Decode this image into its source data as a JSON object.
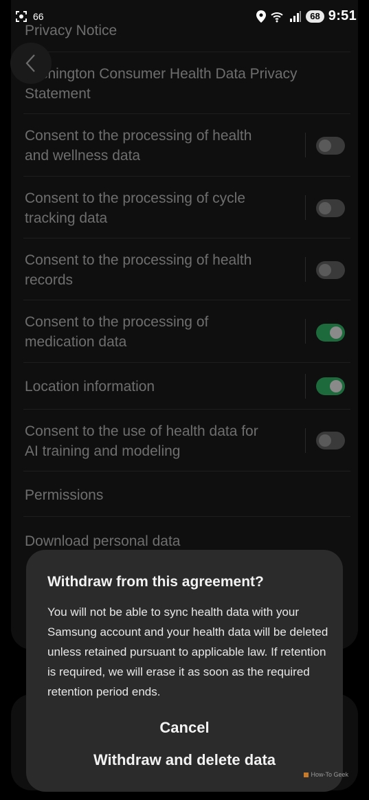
{
  "status_bar": {
    "left_badge": "66",
    "battery": "68",
    "time": "9:51",
    "wifi_label": "7"
  },
  "settings": {
    "privacy_notice": "Privacy Notice",
    "washington_line1": "shington Consumer Health Data Privacy",
    "washington_line2": "Statement",
    "items": [
      {
        "label": "Consent to the processing of health",
        "label2": "and wellness data",
        "toggle": "off"
      },
      {
        "label": "Consent to the processing of cycle",
        "label2": "tracking data",
        "toggle": "off"
      },
      {
        "label": "Consent to the processing of health",
        "label2": "records",
        "toggle": "off"
      },
      {
        "label": "Consent to the processing of",
        "label2": "medication data",
        "toggle": "on"
      },
      {
        "label": "Location information",
        "label2": "",
        "toggle": "on"
      },
      {
        "label": "Consent to the use of health data for",
        "label2": "AI training and modeling",
        "toggle": "off"
      }
    ],
    "permissions": "Permissions",
    "download": "Download personal data"
  },
  "dialog": {
    "title": "Withdraw from this agreement?",
    "body": "You will not be able to sync health data with your Samsung account and your health data will be deleted unless retained pursuant to applicable law. If retention is required, we will erase it as soon as the required retention period ends.",
    "cancel": "Cancel",
    "withdraw": "Withdraw and delete data"
  },
  "watermark": "How-To Geek",
  "colors": {
    "toggle_on": "#1d6b3c",
    "dialog_bg": "#2b2b2b"
  }
}
